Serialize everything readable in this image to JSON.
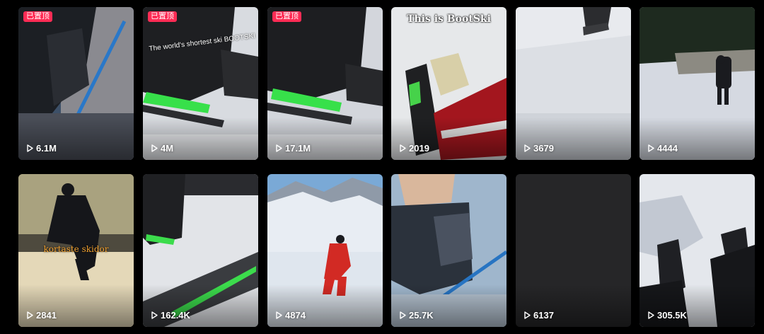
{
  "pinned_label": "已置顶",
  "colors": {
    "pinned_badge": "#fe2c55",
    "background": "#000000"
  },
  "videos": [
    {
      "views": "6.1M",
      "pinned": true,
      "overlay": ""
    },
    {
      "views": "4M",
      "pinned": true,
      "overlay": "The world's shortest ski BOOTSKI"
    },
    {
      "views": "17.1M",
      "pinned": true,
      "overlay": ""
    },
    {
      "views": "2019",
      "pinned": false,
      "overlay": "This is BootSki"
    },
    {
      "views": "3679",
      "pinned": false,
      "overlay": ""
    },
    {
      "views": "4444",
      "pinned": false,
      "overlay": ""
    },
    {
      "views": "2841",
      "pinned": false,
      "overlay": "kortaste skidor"
    },
    {
      "views": "162.4K",
      "pinned": false,
      "overlay": ""
    },
    {
      "views": "4874",
      "pinned": false,
      "overlay": ""
    },
    {
      "views": "25.7K",
      "pinned": false,
      "overlay": ""
    },
    {
      "views": "6137",
      "pinned": false,
      "overlay": ""
    },
    {
      "views": "305.5K",
      "pinned": false,
      "overlay": ""
    }
  ]
}
